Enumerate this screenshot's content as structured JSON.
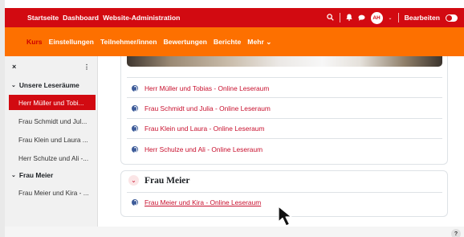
{
  "topbar": {
    "nav": [
      "Startseite",
      "Dashboard",
      "Website-Administration"
    ],
    "user_initials": "AH",
    "edit_mode_label": "Bearbeiten"
  },
  "course_nav": {
    "tabs": [
      "Kurs",
      "Einstellungen",
      "Teilnehmer/innen",
      "Bewertungen",
      "Berichte",
      "Mehr"
    ]
  },
  "sidebar": {
    "close_icon": "×",
    "more_icon": "⋮",
    "sections": [
      {
        "title": "Unsere Leseräume",
        "items": [
          "Herr Müller und Tobi...",
          "Frau Schmidt und Jul...",
          "Frau Klein und Laura ...",
          "Herr Schulze und Ali -..."
        ]
      },
      {
        "title": "Frau Meier",
        "items": [
          "Frau Meier und Kira - ..."
        ]
      }
    ]
  },
  "main": {
    "section1_activities": [
      "Herr Müller und Tobias - Online Leseraum",
      "Frau Schmidt und Julia - Online Leseraum",
      "Frau Klein und Laura - Online Leseraum",
      "Herr Schulze und Ali - Online Leseraum"
    ],
    "section2_title": "Frau Meier",
    "section2_activities": [
      "Frau Meier und Kira - Online Leseraum"
    ]
  },
  "help_label": "?",
  "colors": {
    "brand_red": "#d20a11",
    "brand_orange": "#fd7000",
    "link_red": "#c8102e"
  }
}
